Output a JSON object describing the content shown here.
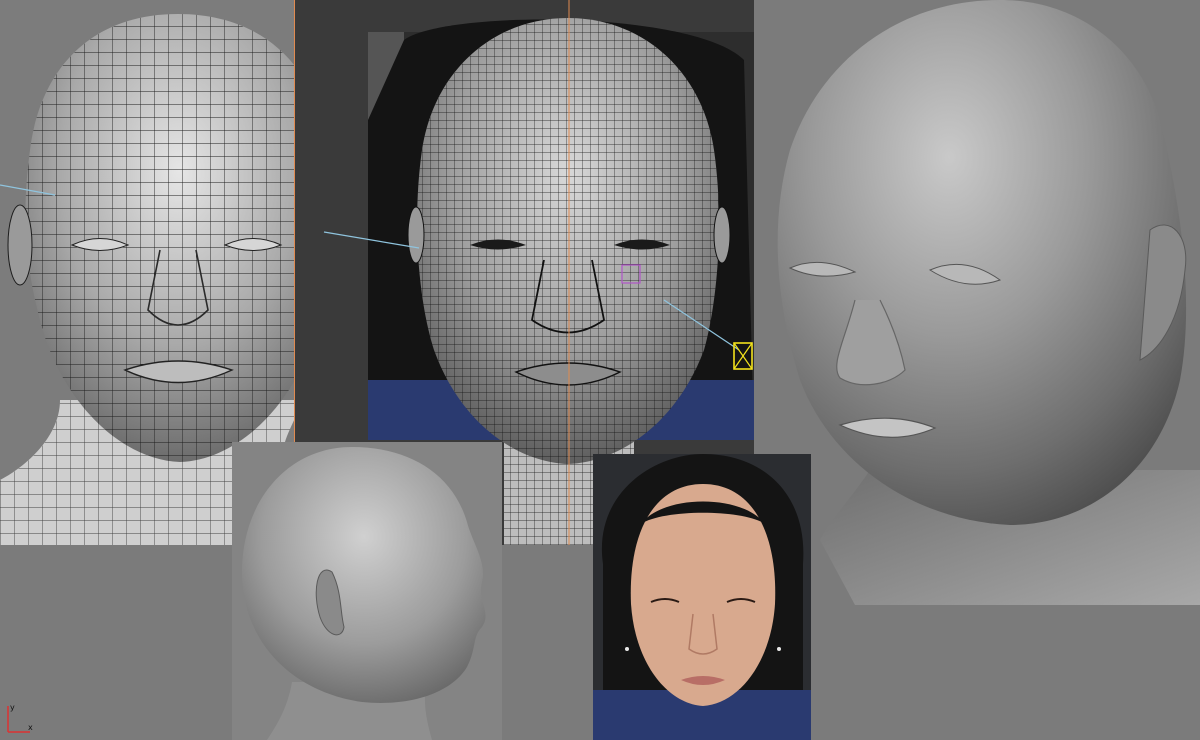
{
  "viewports": [
    {
      "id": "front-wireframe"
    },
    {
      "id": "front-wireframe-with-reference"
    },
    {
      "id": "perspective-render"
    },
    {
      "id": "profile-render"
    },
    {
      "id": "reference-photo"
    }
  ],
  "axis_gizmo": {
    "x_label": "x",
    "y_label": "y"
  },
  "colors": {
    "viewport_bg": "#7b7b7b",
    "viewport_dark": "#3a3a3a",
    "mesh_shade": "#a8a8a8",
    "wire": "#1a1a1a",
    "axis_line": "#e08a50",
    "guide_line": "#8fc4de",
    "selection": "#f2e21c",
    "skin": "#d8a98e",
    "hair": "#141414",
    "shirt": "#2a3a70"
  }
}
